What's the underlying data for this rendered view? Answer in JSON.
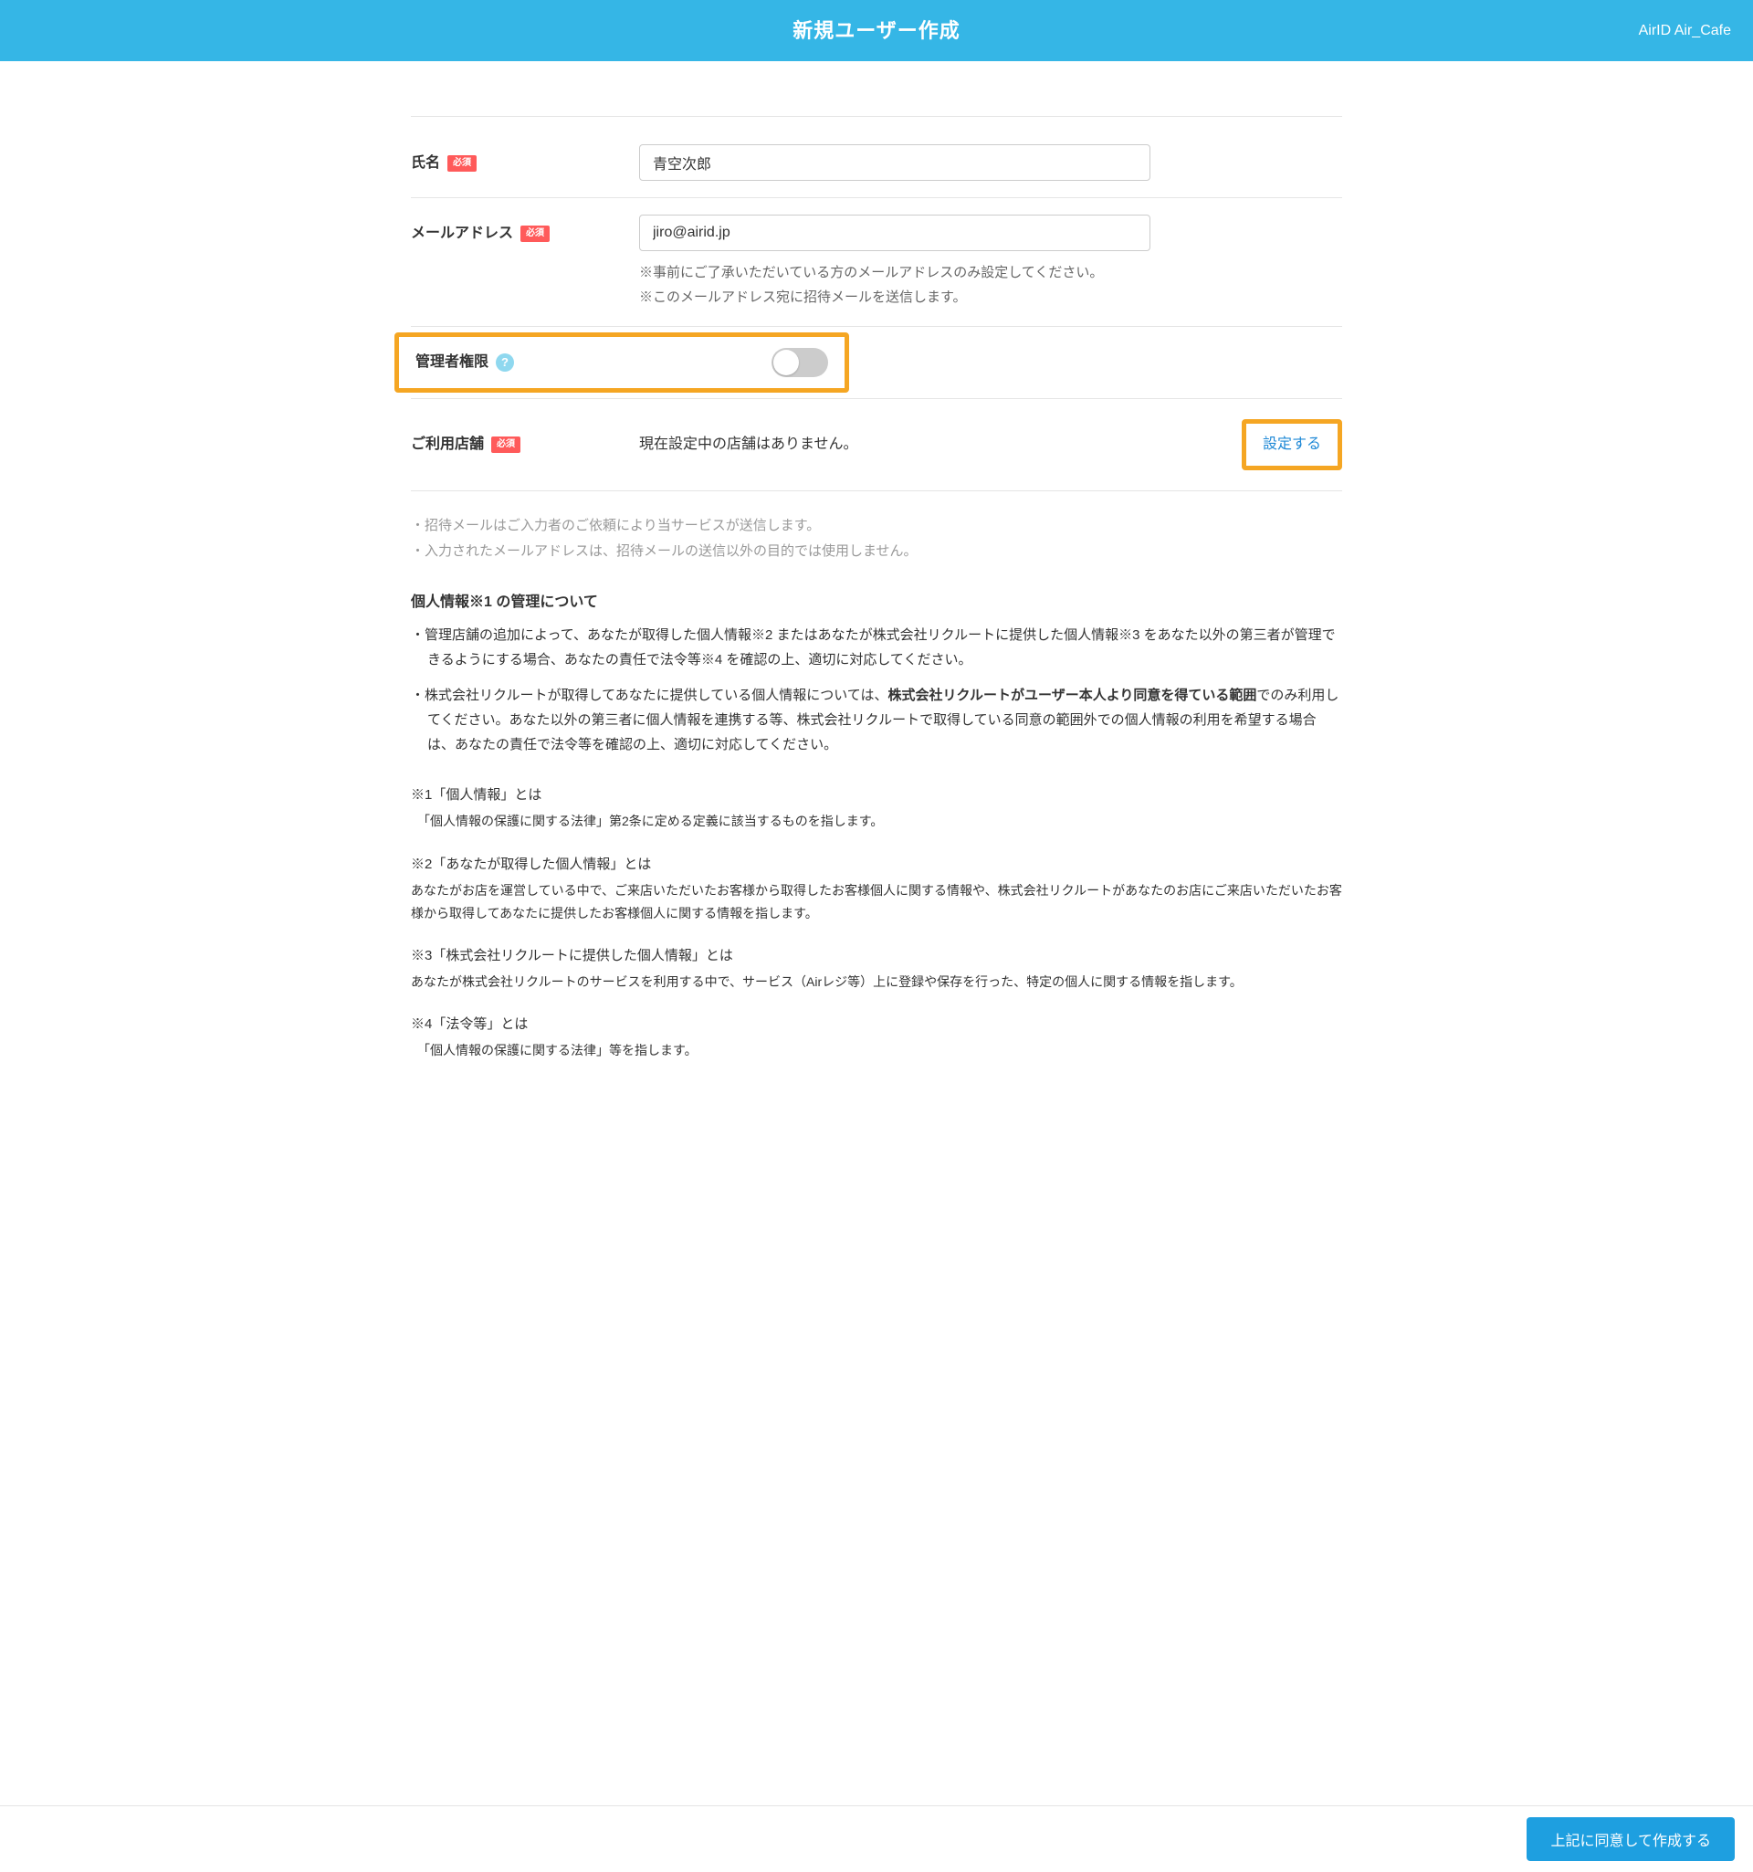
{
  "header": {
    "title": "新規ユーザー作成",
    "account": "AirID Air_Cafe"
  },
  "fields": {
    "name": {
      "label": "氏名",
      "required": "必須",
      "value": "青空次郎"
    },
    "email": {
      "label": "メールアドレス",
      "required": "必須",
      "value": "jiro@airid.jp",
      "helper1": "※事前にご了承いただいている方のメールアドレスのみ設定してください。",
      "helper2": "※このメールアドレス宛に招待メールを送信します。"
    },
    "admin": {
      "label": "管理者権限"
    },
    "stores": {
      "label": "ご利用店舗",
      "required": "必須",
      "status": "現在設定中の店舗はありません。",
      "action": "設定する"
    }
  },
  "notes": {
    "line1": "・招待メールはご入力者のご依頼により当サービスが送信します。",
    "line2": "・入力されたメールアドレスは、招待メールの送信以外の目的では使用しません。"
  },
  "policy": {
    "title": "個人情報※1 の管理について",
    "item1": "・管理店舗の追加によって、あなたが取得した個人情報※2 またはあなたが株式会社リクルートに提供した個人情報※3 をあなた以外の第三者が管理できるようにする場合、あなたの責任で法令等※4 を確認の上、適切に対応してください。",
    "item2_pre": "・株式会社リクルートが取得してあなたに提供している個人情報については、",
    "item2_bold": "株式会社リクルートがユーザー本人より同意を得ている範囲",
    "item2_post": "でのみ利用してください。あなた以外の第三者に個人情報を連携する等、株式会社リクルートで取得している同意の範囲外での個人情報の利用を希望する場合は、あなたの責任で法令等を確認の上、適切に対応してください。"
  },
  "defs": {
    "d1": {
      "term": "※1「個人情報」とは",
      "desc": "「個人情報の保護に関する法律」第2条に定める定義に該当するものを指します。"
    },
    "d2": {
      "term": "※2「あなたが取得した個人情報」とは",
      "desc": "あなたがお店を運営している中で、ご来店いただいたお客様から取得したお客様個人に関する情報や、株式会社リクルートがあなたのお店にご来店いただいたお客様から取得してあなたに提供したお客様個人に関する情報を指します。"
    },
    "d3": {
      "term": "※3「株式会社リクルートに提供した個人情報」とは",
      "desc": "あなたが株式会社リクルートのサービスを利用する中で、サービス（Airレジ等）上に登録や保存を行った、特定の個人に関する情報を指します。"
    },
    "d4": {
      "term": "※4「法令等」とは",
      "desc": "「個人情報の保護に関する法律」等を指します。"
    }
  },
  "footer": {
    "submit": "上記に同意して作成する"
  }
}
